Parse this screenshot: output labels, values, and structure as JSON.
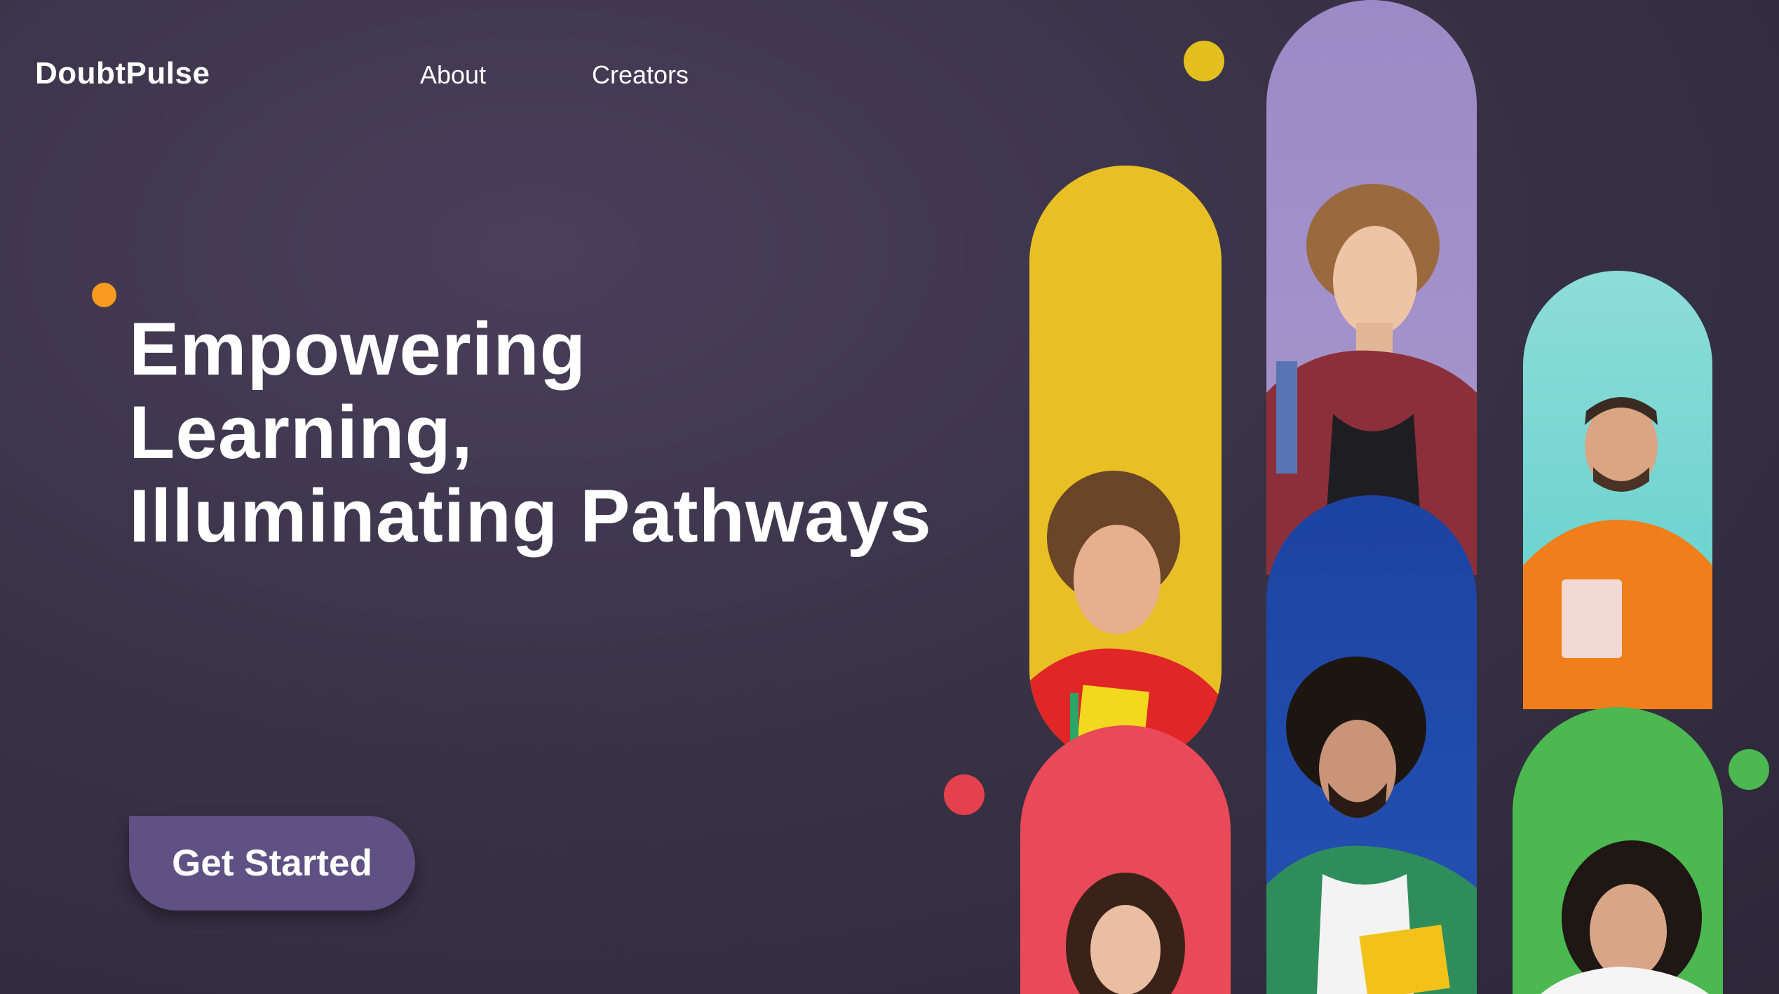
{
  "header": {
    "brand": "DoubtPulse",
    "nav": [
      {
        "label": "About"
      },
      {
        "label": "Creators"
      }
    ]
  },
  "hero": {
    "title_lines": [
      "Empowering",
      "Learning,",
      "Illuminating Pathways"
    ],
    "cta_label": "Get Started"
  },
  "colors": {
    "background": "#3a3347",
    "cta": "#5f5184",
    "accent_orange": "#f79a1f",
    "accent_yellow": "#e3c01e",
    "accent_red": "#e4404d",
    "accent_green": "#4cb850",
    "pill_yellow": "#e8bf24",
    "pill_lilac": "#9b8ac7",
    "pill_teal": "#6fd3cf",
    "pill_red": "#e94958",
    "pill_blue": "#1c43a2",
    "pill_green": "#4cb850"
  },
  "gallery": [
    {
      "name": "student-curly-hair-red-hoodie",
      "bg": "pill_yellow"
    },
    {
      "name": "student-short-hair-plaid-shirt",
      "bg": "pill_lilac"
    },
    {
      "name": "student-orange-sweater-tablet",
      "bg": "pill_teal"
    },
    {
      "name": "student-long-dark-hair",
      "bg": "pill_red"
    },
    {
      "name": "student-curly-hair-green-shirt",
      "bg": "pill_blue"
    },
    {
      "name": "student-dark-hair-smiling",
      "bg": "pill_green"
    }
  ]
}
